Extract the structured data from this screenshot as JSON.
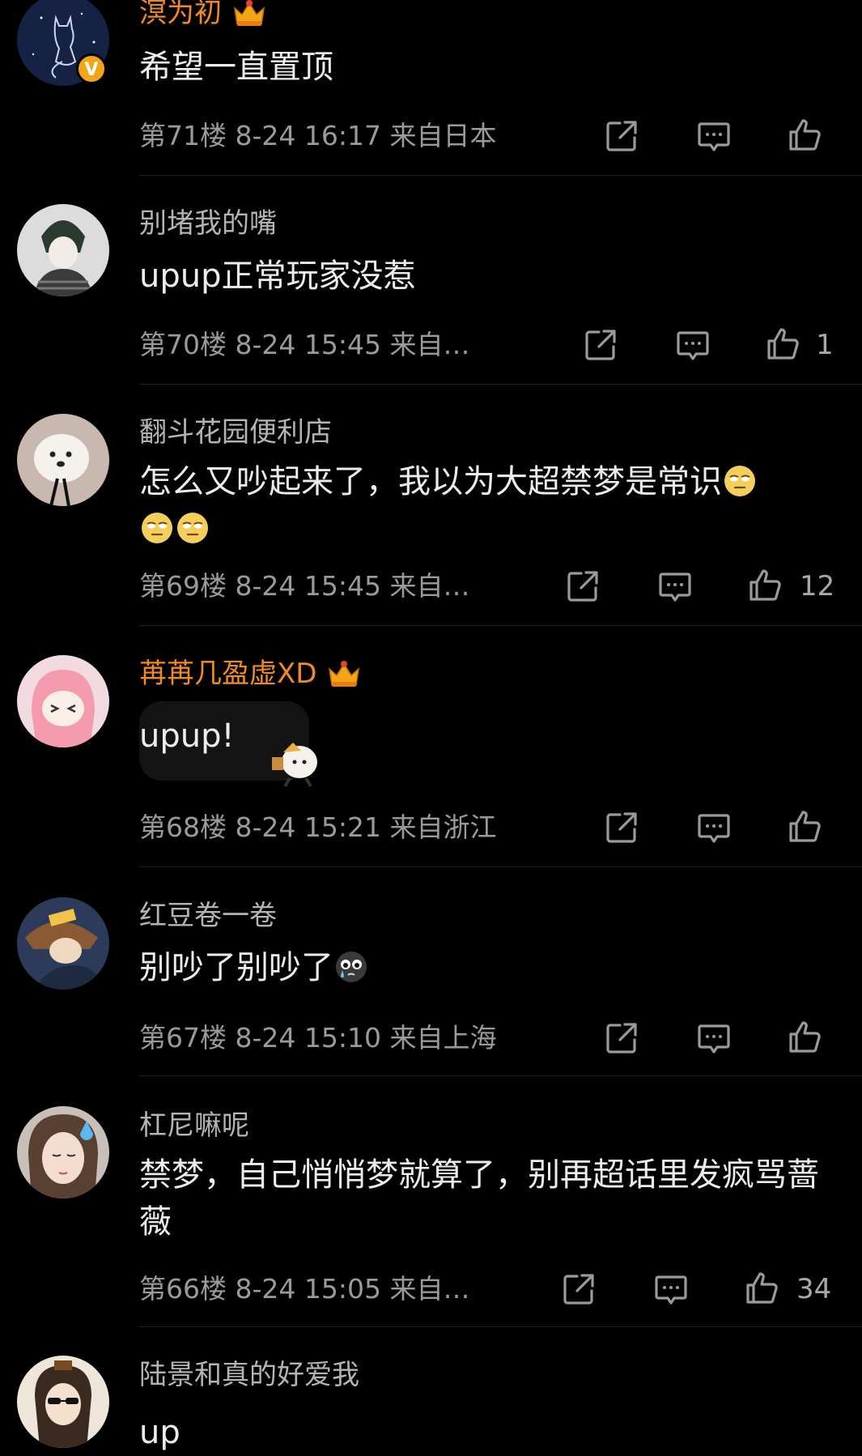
{
  "comments": [
    {
      "username": "溟为初",
      "vip": true,
      "crown_level": "7",
      "verified": true,
      "verified_badge": "V",
      "text": "希望一直置顶",
      "meta": "第71楼  8-24 16:17  来自日本",
      "likes": ""
    },
    {
      "username": "别堵我的嘴",
      "vip": false,
      "text": "upup正常玩家没惹",
      "meta": "第70楼  8-24 15:45  来自…",
      "likes": "1"
    },
    {
      "username": "翻斗花园便利店",
      "vip": false,
      "text": "怎么又吵起来了，我以为大超禁梦是常识",
      "meta": "第69楼  8-24 15:45  来自…",
      "likes": "12"
    },
    {
      "username": "苒苒几盈虚XD",
      "vip": true,
      "crown_level": "4",
      "text": "upup!",
      "meta": "第68楼  8-24 15:21  来自浙江",
      "likes": ""
    },
    {
      "username": "红豆卷一卷",
      "vip": false,
      "text": "别吵了别吵了",
      "meta": "第67楼  8-24 15:10  来自上海",
      "likes": ""
    },
    {
      "username": "杠尼嘛呢",
      "vip": false,
      "text": "禁梦，自己悄悄梦就算了，别再超话里发疯骂蔷薇",
      "meta": "第66楼  8-24 15:05  来自…",
      "likes": "34"
    },
    {
      "username": "陆景和真的好爱我",
      "vip": false,
      "text": "up",
      "meta": "",
      "likes": ""
    }
  ],
  "icons": {
    "share": "share-icon",
    "reply": "comment-icon",
    "like": "thumbs-up-icon",
    "emoji_eyeroll": "eye-roll-emoji",
    "emoji_cry": "crying-emoji"
  },
  "colors": {
    "background": "#000000",
    "vip_name": "#f08a24",
    "name": "#b4b4b4",
    "text": "#ececec",
    "meta": "#9a9a9a"
  }
}
